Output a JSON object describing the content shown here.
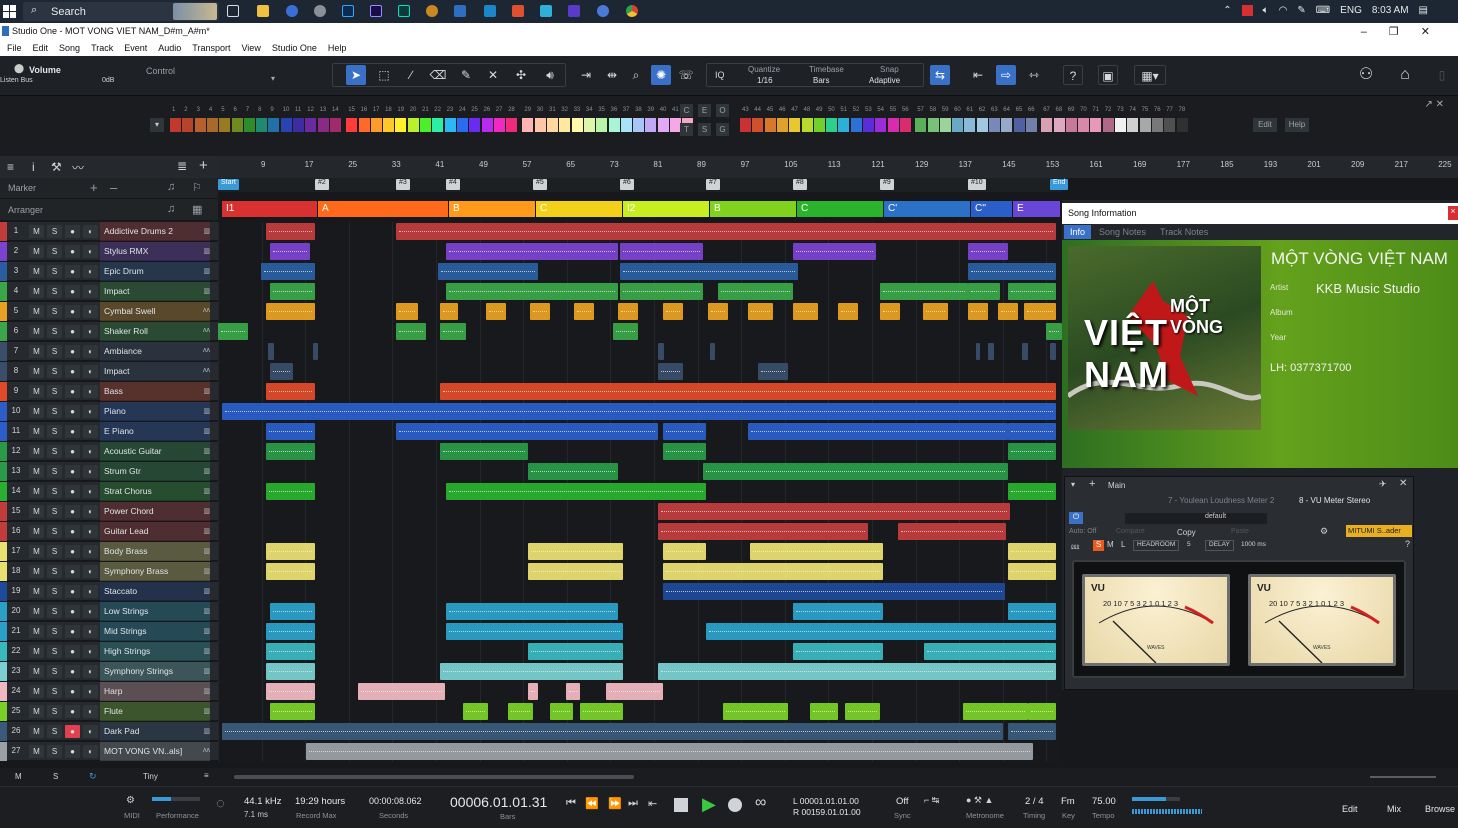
{
  "taskbar": {
    "search_label": "Search",
    "lang": "ENG",
    "time": "8:03 AM"
  },
  "window": {
    "title": "Studio One - MOT VONG VIET NAM_D#m_A#m*"
  },
  "menu": [
    "File",
    "Edit",
    "Song",
    "Track",
    "Event",
    "Audio",
    "Transport",
    "View",
    "Studio One",
    "Help"
  ],
  "toolbar": {
    "volume_label": "Volume",
    "bus_label": "Listen Bus",
    "db_value": "0dB",
    "control_label": "Control",
    "iq_label": "IQ",
    "quantize_label": "Quantize",
    "quantize_value": "1/16",
    "timebase_label": "Timebase",
    "timebase_value": "Bars",
    "snap_label": "Snap",
    "snap_value": "Adaptive",
    "help_icon": "?"
  },
  "palette": {
    "colors_a": [
      "#c0392b",
      "#b5442a",
      "#b7602d",
      "#a86a2b",
      "#9a7a20",
      "#6f8a1f",
      "#2e8d2a",
      "#1e8a70",
      "#2071a8",
      "#2b43b0",
      "#3e2ca3",
      "#6a2aa0",
      "#8a2a86",
      "#a12a6a"
    ],
    "colors_b": [
      "#ff3b3b",
      "#ff6a2a",
      "#ff9b2a",
      "#ffc72a",
      "#fff02a",
      "#b9f02a",
      "#4cf02a",
      "#2af0a6",
      "#2ab9f0",
      "#2a6cf0",
      "#6a2af0",
      "#b92af0",
      "#f02ac0",
      "#f02a7a"
    ],
    "colors_c": [
      "#ffb3b3",
      "#ffc7a8",
      "#ffd8a0",
      "#ffe9a0",
      "#fff8a8",
      "#dff5a8",
      "#b8f5a8",
      "#a8f5d6",
      "#a8e4f5",
      "#a8c6f5",
      "#c0a8f5",
      "#e0a8f5",
      "#f5a8e6",
      "#f5a8c6"
    ],
    "colors_d": [
      "#c83232",
      "#d0502c",
      "#d8782c",
      "#e0a02c",
      "#e8c82c",
      "#b8d82c",
      "#70d02c",
      "#2cd08c",
      "#2cb0d8",
      "#2c70d8",
      "#5c2cd8",
      "#9c2cd8",
      "#d82cb0",
      "#d82c6c"
    ],
    "colors_e": [
      "#5ab05a",
      "#78c278",
      "#9ad49a",
      "#6aa8c8",
      "#8ab8d8",
      "#a0c8e0",
      "#7888b8",
      "#98a8c8",
      "#5060a0",
      "#7080a8"
    ],
    "colors_f": [
      "#d8a0b0",
      "#e0a8c0",
      "#c87898",
      "#d888a8",
      "#e898b8",
      "#b06888",
      "#f0f0f0",
      "#d0d0d0",
      "#a8a8a8",
      "#787878",
      "#505050",
      "#303030"
    ],
    "letters": [
      "C",
      "E",
      "O",
      "T",
      "S",
      "G"
    ],
    "edit_label": "Edit",
    "help_label": "Help"
  },
  "ruler": {
    "bars": [
      "9",
      "17",
      "25",
      "33",
      "41",
      "49",
      "57",
      "65",
      "73",
      "81",
      "89",
      "97",
      "105",
      "113",
      "121",
      "129",
      "137",
      "145",
      "153",
      "161",
      "169",
      "177",
      "185",
      "193",
      "201",
      "209",
      "217",
      "225"
    ]
  },
  "markers": {
    "labels": [
      "Start",
      "#2",
      "#3",
      "#4",
      "#5",
      "#6",
      "#7",
      "#8",
      "#9",
      "#10",
      "End"
    ]
  },
  "left_panel": {
    "marker_label": "Marker",
    "arranger_label": "Arranger"
  },
  "arranger": [
    {
      "label": "I1",
      "color": "#d8312f",
      "w": 96
    },
    {
      "label": "A",
      "color": "#ff6a1a",
      "w": 131
    },
    {
      "label": "B",
      "color": "#ff9a1a",
      "w": 87
    },
    {
      "label": "C",
      "color": "#f3d11b",
      "w": 87
    },
    {
      "label": "I2",
      "color": "#c9ee1f",
      "w": 87
    },
    {
      "label": "B",
      "color": "#80d21e",
      "w": 87
    },
    {
      "label": "C",
      "color": "#2bb32b",
      "w": 87
    },
    {
      "label": "C'",
      "color": "#2b71c8",
      "w": 87
    },
    {
      "label": "C''",
      "color": "#2b5ec8",
      "w": 42
    },
    {
      "label": "E",
      "color": "#6a46d8",
      "w": 48
    }
  ],
  "tracks": [
    {
      "n": "1",
      "name": "Addictive Drums 2",
      "color": "#c23c3c",
      "icon": "keys"
    },
    {
      "n": "2",
      "name": "Stylus RMX",
      "color": "#7b43d0",
      "icon": "keys"
    },
    {
      "n": "3",
      "name": "Epic Drum",
      "color": "#2b5ea0",
      "icon": "keys"
    },
    {
      "n": "4",
      "name": "Impact",
      "color": "#3aa648",
      "icon": "keys"
    },
    {
      "n": "5",
      "name": "Cymbal Swell",
      "color": "#e8a020",
      "icon": "wave"
    },
    {
      "n": "6",
      "name": "Shaker Roll",
      "color": "#3aa648",
      "icon": "wave"
    },
    {
      "n": "7",
      "name": "Ambiance",
      "color": "#3a4e6a",
      "icon": "wave"
    },
    {
      "n": "8",
      "name": "Impact",
      "color": "#3a4e6a",
      "icon": "wave"
    },
    {
      "n": "9",
      "name": "Bass",
      "color": "#e04a2a",
      "icon": "keys"
    },
    {
      "n": "10",
      "name": "Piano",
      "color": "#2b5ec8",
      "icon": "keys"
    },
    {
      "n": "11",
      "name": "E Piano",
      "color": "#2b5ec8",
      "icon": "keys"
    },
    {
      "n": "12",
      "name": "Acoustic Guitar",
      "color": "#2a9a48",
      "icon": "keys"
    },
    {
      "n": "13",
      "name": "Strum Gtr",
      "color": "#2a9a48",
      "icon": "keys"
    },
    {
      "n": "14",
      "name": "Strat Chorus",
      "color": "#2ab030",
      "icon": "keys"
    },
    {
      "n": "15",
      "name": "Power Chord",
      "color": "#c23c3c",
      "icon": "keys"
    },
    {
      "n": "16",
      "name": "Guitar Lead",
      "color": "#c23c3c",
      "icon": "keys"
    },
    {
      "n": "17",
      "name": "Body Brass",
      "color": "#e8e070",
      "icon": "keys"
    },
    {
      "n": "18",
      "name": "Symphony Brass",
      "color": "#e8e070",
      "icon": "keys"
    },
    {
      "n": "19",
      "name": "Staccato",
      "color": "#1f4a9a",
      "icon": "keys"
    },
    {
      "n": "20",
      "name": "Low Strings",
      "color": "#2aa0c8",
      "icon": "keys"
    },
    {
      "n": "21",
      "name": "Mid Strings",
      "color": "#2aa0c8",
      "icon": "keys"
    },
    {
      "n": "22",
      "name": "High Strings",
      "color": "#3ab8c0",
      "icon": "keys"
    },
    {
      "n": "23",
      "name": "Symphony Strings",
      "color": "#7ad0d0",
      "icon": "keys"
    },
    {
      "n": "24",
      "name": "Harp",
      "color": "#f0b8c0",
      "icon": "keys"
    },
    {
      "n": "25",
      "name": "Flute",
      "color": "#7ad028",
      "icon": "keys"
    },
    {
      "n": "26",
      "name": "Dark Pad",
      "color": "#3a5a7a",
      "icon": "keys"
    },
    {
      "n": "27",
      "name": "MOT VONG VN..als]",
      "color": "#9aa0a6",
      "icon": "wave"
    }
  ],
  "song_info": {
    "panel_title": "Song Information",
    "tabs": [
      "Info",
      "Song Notes",
      "Track Notes"
    ],
    "song_title": "MỘT VÒNG VIỆT NAM",
    "artist_label": "Artist",
    "artist_value": "KKB Music Studio",
    "album_label": "Album",
    "year_label": "Year",
    "contact": "LH: 0377371700",
    "cover_line1": "MỘT VÒNG",
    "cover_line2": "VIỆT NAM"
  },
  "plugin": {
    "title": "Main",
    "slot_name": "7 - Youlean Loudness Meter 2",
    "meter_name": "8 - VU Meter Stereo",
    "preset": "default",
    "auto_label": "Auto: Off",
    "compare_label": "Compare",
    "copy_label": "Copy",
    "paste_label": "Paste",
    "user_label": "MITUMI S..ader",
    "headroom_label": "HEADROOM",
    "headroom_value": "5",
    "delay_label": "DELAY",
    "delay_value": "1000 ms",
    "vu_label": "VU",
    "vu_brand": "WAVES",
    "vu_scale": "20 10 7 5 3 2 1 0 1 2 3"
  },
  "bottom": {
    "m_label": "M",
    "s_label": "S",
    "tiny_label": "Tiny"
  },
  "transport": {
    "midi_label": "MIDI",
    "performance_label": "Performance",
    "sample_rate": "44.1 kHz",
    "latency": "7.1 ms",
    "record_hours": "19:29 hours",
    "record_max_label": "Record Max",
    "seconds_value": "00:00:08.062",
    "seconds_label": "Seconds",
    "bars_value": "00006.01.01.31",
    "bars_label": "Bars",
    "loop_l": "L  00001.01.01.00",
    "loop_r": "R  00159.01.01.00",
    "sync_value": "Off",
    "sync_label": "Sync",
    "metronome_label": "Metronome",
    "timing_value": "2 / 4",
    "timing_label": "Timing",
    "key_value": "Fm",
    "key_label": "Key",
    "tempo_value": "75.00",
    "tempo_label": "Tempo",
    "edit_btn": "Edit",
    "mix_btn": "Mix",
    "browse_btn": "Browse"
  }
}
